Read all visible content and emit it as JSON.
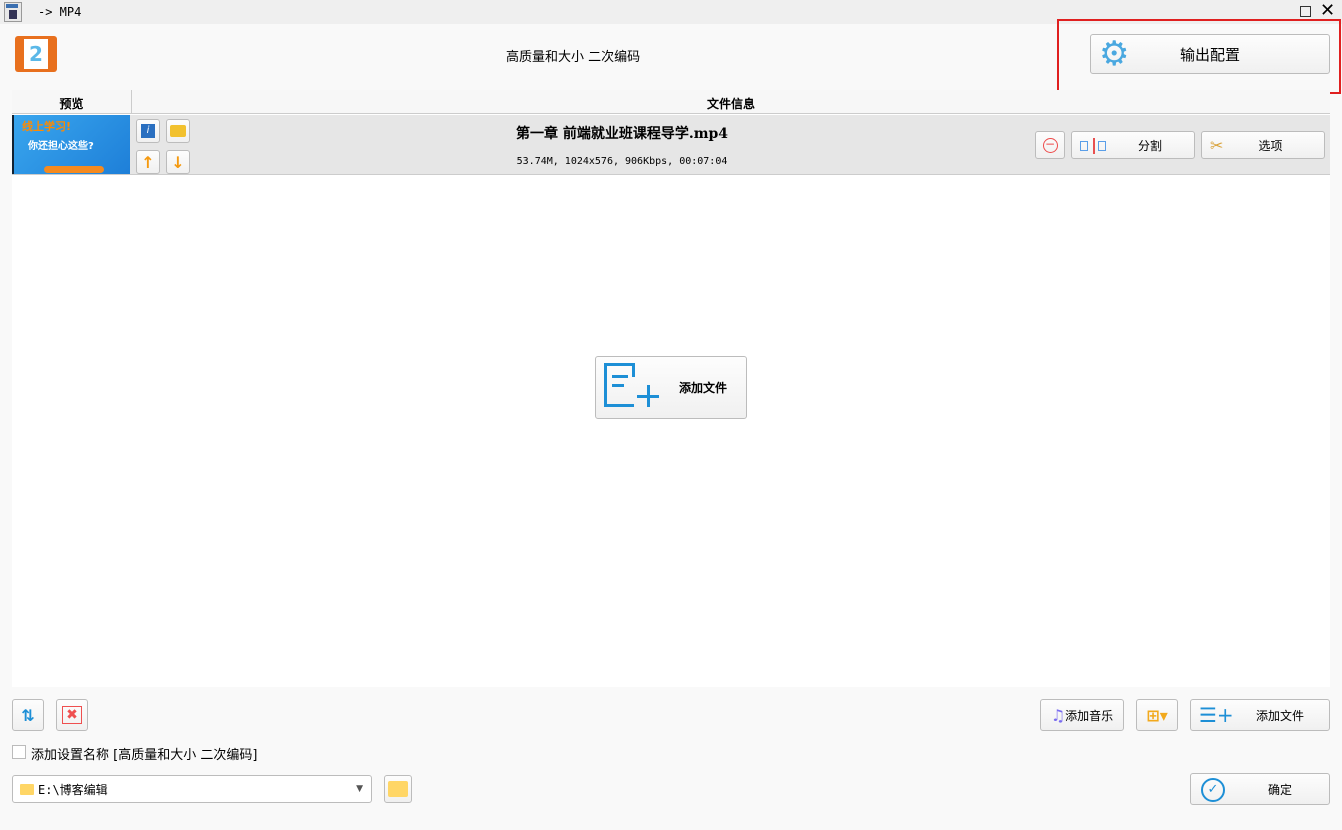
{
  "window": {
    "title": "-> MP4",
    "app_icon": "mp4-file-icon"
  },
  "header": {
    "preset_name": "高质量和大小 二次编码",
    "output_config_label": "输出配置",
    "highlight_color": "#e02020"
  },
  "table": {
    "col_preview": "预览",
    "col_info": "文件信息"
  },
  "file": {
    "name": "第一章 前端就业班课程导学.mp4",
    "meta": "53.74M, 1024x576, 906Kbps, 00:07:04",
    "split_label": "分割",
    "options_label": "选项"
  },
  "center": {
    "add_file_label": "添加文件"
  },
  "bottom": {
    "add_music_label": "添加音乐",
    "add_file_label": "添加文件",
    "checkbox_label": "添加设置名称 [高质量和大小 二次编码]",
    "checkbox_checked": false,
    "output_path": "E:\\博客编辑",
    "ok_label": "确定"
  }
}
